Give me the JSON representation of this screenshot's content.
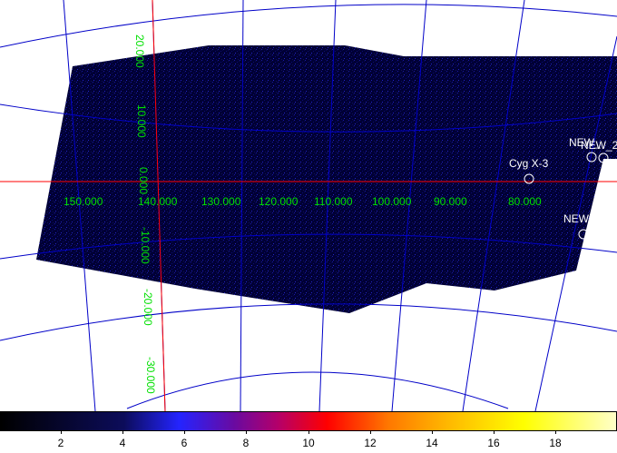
{
  "image": {
    "colors": {
      "background": "#ffffff",
      "exposure": "#000035",
      "grid": "#0000c8",
      "crosshair": "#ff0000",
      "grid_labels": "#00e000",
      "sources": "#ffffff"
    }
  },
  "longitude_labels": [
    "150.000",
    "140.000",
    "130.000",
    "120.000",
    "110.000",
    "100.000",
    "90.000",
    "80.000"
  ],
  "latitude_labels": [
    "20.000",
    "10.000",
    "0.000",
    "-10.000",
    "-20.000",
    "-30.000"
  ],
  "sources": [
    {
      "name": "Cyg X-3"
    },
    {
      "name": "NEW_"
    },
    {
      "name": "NEW_2"
    },
    {
      "name": "NEW"
    }
  ],
  "colorbar": {
    "ticks": [
      "2",
      "4",
      "6",
      "8",
      "10",
      "12",
      "14",
      "16",
      "18"
    ]
  }
}
